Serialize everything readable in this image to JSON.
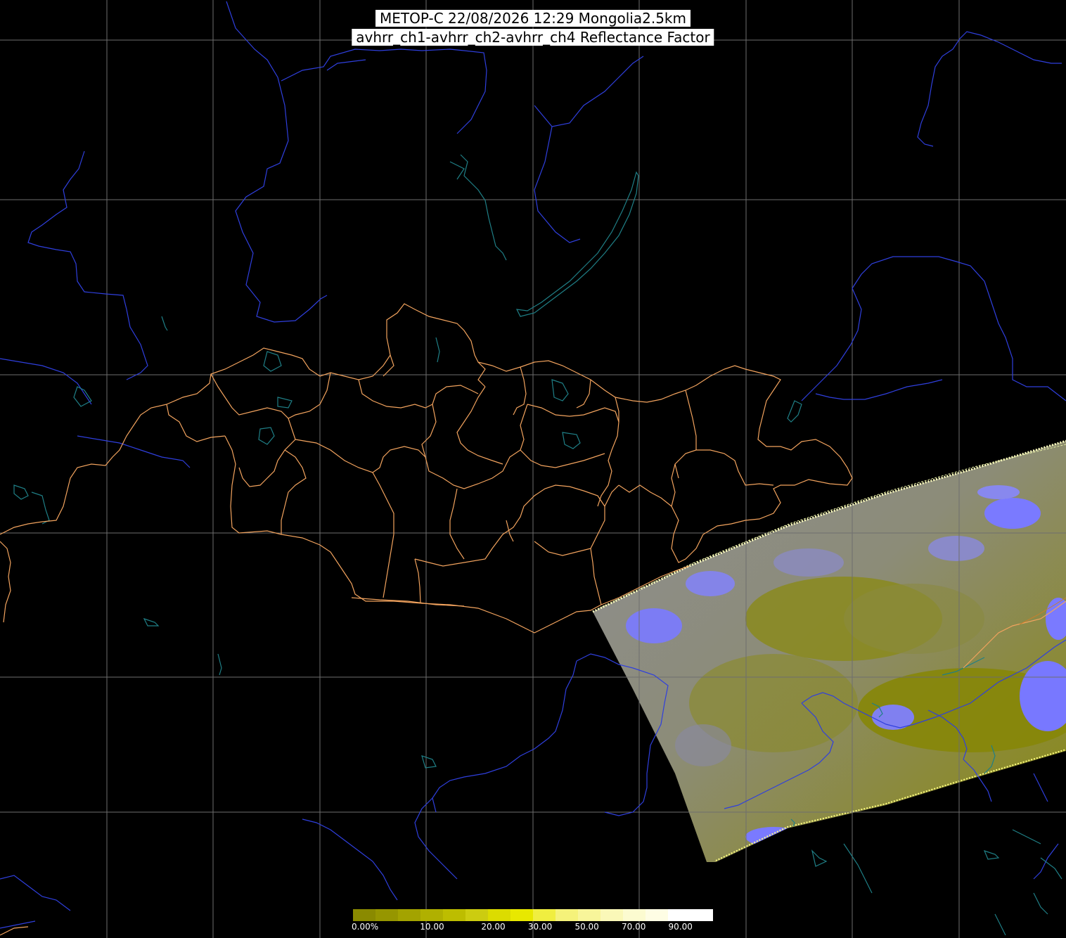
{
  "title": {
    "line1": "METOP-C 22/08/2026 12:29 Mongolia2.5km",
    "line2": "avhrr_ch1-avhrr_ch2-avhrr_ch4 Reflectance Factor"
  },
  "colors": {
    "background": "#000000",
    "grid": "#6e6e6e",
    "rivers": "#2f3fdd",
    "coast": "#1f7f86",
    "borders": "#f2a35e",
    "swath_gray": "#8c8c8c",
    "swath_olive": "#8a8a00",
    "cloud": "#7a7aff"
  },
  "legend": {
    "colors": [
      "#8a8a00",
      "#969600",
      "#a3a300",
      "#b0b000",
      "#bdbd00",
      "#cccc10",
      "#dcdc00",
      "#e8e800",
      "#f0ee40",
      "#f5f27a",
      "#f8f59a",
      "#faf8b8",
      "#fcfbd0",
      "#fefde4",
      "#ffffff",
      "#ffffff"
    ],
    "ticks": [
      {
        "label": "0.00%",
        "pos": 0.0
      },
      {
        "label": "10.00",
        "pos": 0.19
      },
      {
        "label": "20.00",
        "pos": 0.36
      },
      {
        "label": "30.00",
        "pos": 0.49
      },
      {
        "label": "50.00",
        "pos": 0.62
      },
      {
        "label": "70.00",
        "pos": 0.75
      },
      {
        "label": "90.00",
        "pos": 0.88
      }
    ]
  }
}
